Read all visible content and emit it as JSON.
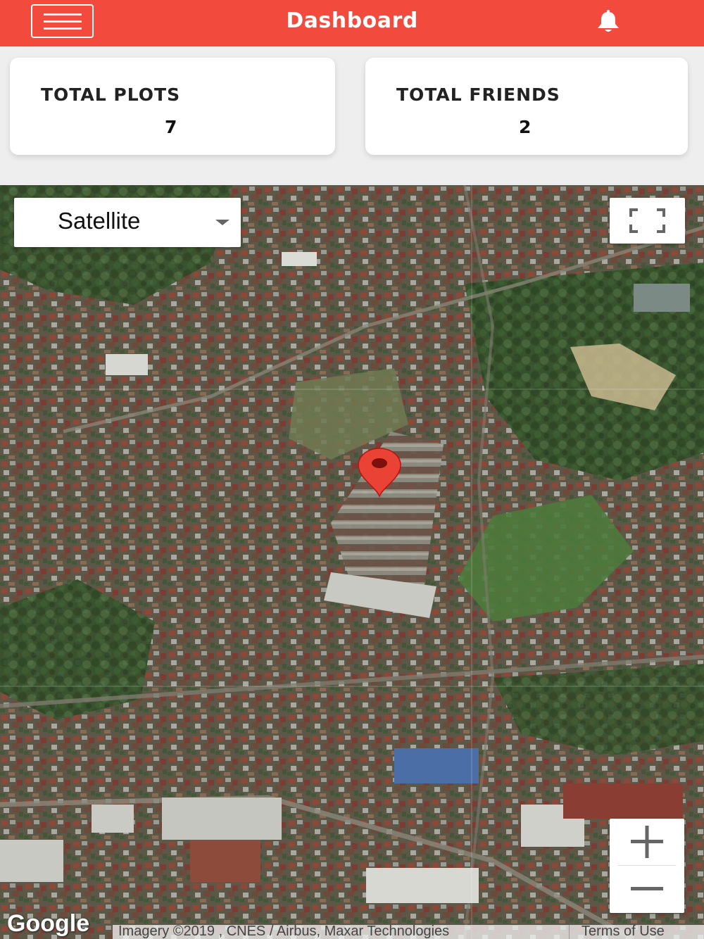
{
  "header": {
    "title": "Dashboard",
    "menu_icon": "hamburger-menu-icon",
    "notification_icon": "bell-icon",
    "background_color": "#f24a3d"
  },
  "stats": [
    {
      "label": "TOTAL PLOTS",
      "value": "7"
    },
    {
      "label": "TOTAL FRIENDS",
      "value": "2"
    }
  ],
  "map": {
    "map_type": "Satellite",
    "fullscreen_icon": "fullscreen-icon",
    "zoom_in_icon": "plus-icon",
    "zoom_out_icon": "minus-icon",
    "marker_icon": "map-pin-icon",
    "marker_color": "#ea4335",
    "logo": "Google",
    "attribution": "Imagery ©2019 , CNES / Airbus, Maxar Technologies",
    "terms": "Terms of Use"
  }
}
